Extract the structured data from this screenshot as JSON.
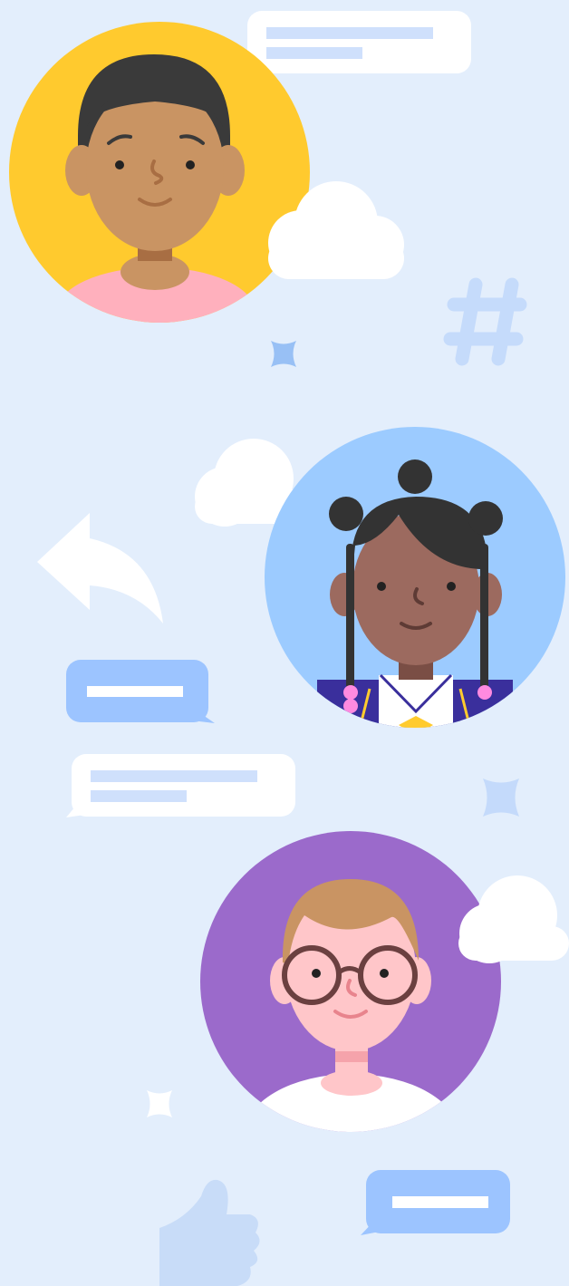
{
  "illustration": {
    "background_color": "#e3eefc",
    "avatars": [
      {
        "name": "avatar-boy",
        "bg_color": "#ffca2e",
        "skin": "#c99463",
        "hair": "#3a3a3a",
        "shirt": "#ffb0bd"
      },
      {
        "name": "avatar-girl-buns",
        "bg_color": "#9ccbff",
        "skin": "#9c6a5f",
        "hair": "#333333",
        "jacket": "#3a2f9c"
      },
      {
        "name": "avatar-glasses",
        "bg_color": "#9b6acb",
        "skin": "#ffc6c9",
        "hair": "#c99463",
        "shirt": "#ffffff"
      }
    ],
    "decor_colors": {
      "bubble_white": "#ffffff",
      "bubble_blue": "#9cc4ff",
      "text_line_light": "#cfe0fc",
      "hashtag": "#c5dbfb",
      "star_blue": "#98c0f5",
      "star_light": "#c4dafb",
      "thumbs_up": "#c8dcf8",
      "reply_arrow": "#ffffff",
      "cloud": "#ffffff"
    },
    "icons": [
      "hashtag-icon",
      "reply-arrow-icon",
      "thumbs-up-icon",
      "sparkle-star-icon",
      "cloud-icon",
      "chat-bubble-icon"
    ]
  }
}
